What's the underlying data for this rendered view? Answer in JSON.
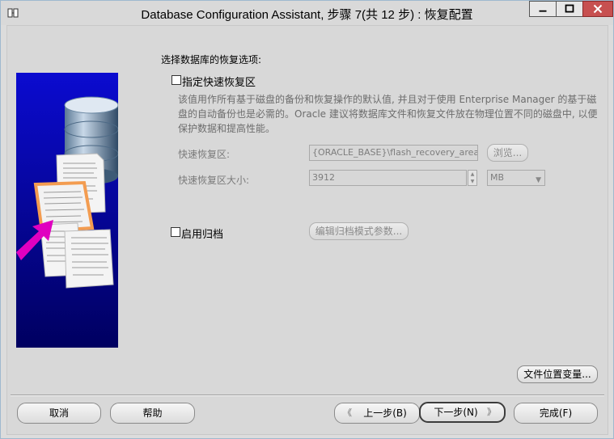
{
  "window": {
    "title": "Database Configuration Assistant, 步骤 7(共 12 步) : 恢复配置"
  },
  "main": {
    "section_title": "选择数据库的恢复选项:",
    "fast_recovery": {
      "checkbox_label": "指定快速恢复区",
      "checked": false,
      "description": "该值用作所有基于磁盘的备份和恢复操作的默认值, 并且对于使用 Enterprise Manager 的基于磁盘的自动备份也是必需的。Oracle 建议将数据库文件和恢复文件放在物理位置不同的磁盘中, 以便保护数据和提高性能。",
      "area_label": "快速恢复区:",
      "area_value": "{ORACLE_BASE}\\flash_recovery_area",
      "browse_label": "浏览...",
      "size_label": "快速恢复区大小:",
      "size_value": "3912",
      "unit_value": "MB"
    },
    "archive": {
      "checkbox_label": "启用归档",
      "checked": false,
      "params_button": "编辑归档模式参数..."
    },
    "file_location_button": "文件位置变量..."
  },
  "footer": {
    "cancel": "取消",
    "help": "帮助",
    "back": "上一步(B)",
    "next": "下一步(N)",
    "finish": "完成(F)"
  },
  "icons": {
    "app": "dbca-app-icon",
    "back_arrow": "chevron-left-icon",
    "next_arrow": "chevron-right-icon"
  },
  "colors": {
    "graphic_blue": "#1010c8",
    "arrow_magenta": "#e000c0",
    "close_button": "#c75050"
  }
}
